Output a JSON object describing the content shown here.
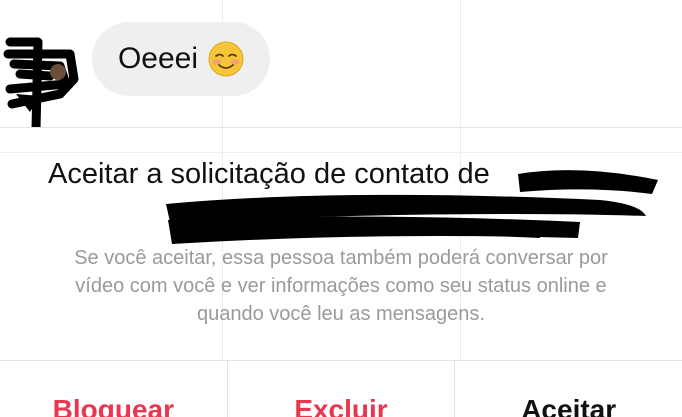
{
  "conversation": {
    "messages": [
      {
        "text": "Oeeei",
        "emoji": "smiling-blushing-emoji"
      }
    ]
  },
  "request": {
    "title": "Aceitar a solicitação de contato de",
    "description_lines": [
      "Se você aceitar, essa pessoa também poderá conversar por",
      "vídeo com você e ver informações como seu status online e",
      "quando você leu as mensagens."
    ]
  },
  "actions": {
    "block_label": "Bloquear",
    "delete_label": "Excluir",
    "accept_label": "Aceitar"
  },
  "colors": {
    "danger": "#e8374f",
    "text": "#111111",
    "muted": "#9a9a9a",
    "bubble": "#efefef"
  }
}
